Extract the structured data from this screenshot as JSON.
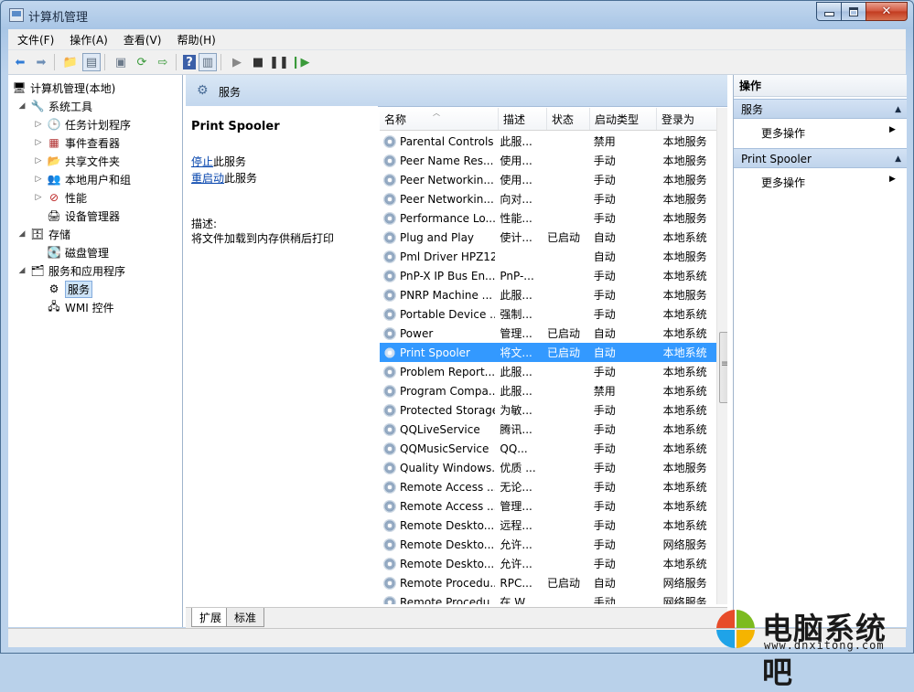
{
  "window": {
    "title": "计算机管理"
  },
  "menu": [
    "文件(F)",
    "操作(A)",
    "查看(V)",
    "帮助(H)"
  ],
  "tree": {
    "root": "计算机管理(本地)",
    "system_tools": "系统工具",
    "task_scheduler": "任务计划程序",
    "event_viewer": "事件查看器",
    "shared_folders": "共享文件夹",
    "local_users": "本地用户和组",
    "performance": "性能",
    "device_manager": "设备管理器",
    "storage": "存储",
    "disk_management": "磁盘管理",
    "services_apps": "服务和应用程序",
    "services": "服务",
    "wmi": "WMI 控件"
  },
  "middle": {
    "header": "服务",
    "detail_title": "Print Spooler",
    "stop_link": "停止",
    "stop_suffix": "此服务",
    "restart_link": "重启动",
    "restart_suffix": "此服务",
    "desc_label": "描述:",
    "desc_text": "将文件加载到内存供稍后打印",
    "tabs": [
      "扩展",
      "标准"
    ]
  },
  "list": {
    "columns": [
      "名称",
      "描述",
      "状态",
      "启动类型",
      "登录为"
    ],
    "rows": [
      [
        "Parental Controls",
        "此服...",
        "",
        "禁用",
        "本地服务"
      ],
      [
        "Peer Name Res...",
        "使用...",
        "",
        "手动",
        "本地服务"
      ],
      [
        "Peer Networkin...",
        "使用...",
        "",
        "手动",
        "本地服务"
      ],
      [
        "Peer Networkin...",
        "向对...",
        "",
        "手动",
        "本地服务"
      ],
      [
        "Performance Lo...",
        "性能...",
        "",
        "手动",
        "本地服务"
      ],
      [
        "Plug and Play",
        "使计...",
        "已启动",
        "自动",
        "本地系统"
      ],
      [
        "Pml Driver HPZ12",
        "",
        "",
        "自动",
        "本地服务"
      ],
      [
        "PnP-X IP Bus En...",
        "PnP-...",
        "",
        "手动",
        "本地系统"
      ],
      [
        "PNRP Machine ...",
        "此服...",
        "",
        "手动",
        "本地服务"
      ],
      [
        "Portable Device ...",
        "强制...",
        "",
        "手动",
        "本地系统"
      ],
      [
        "Power",
        "管理...",
        "已启动",
        "自动",
        "本地系统"
      ],
      [
        "Print Spooler",
        "将文...",
        "已启动",
        "自动",
        "本地系统"
      ],
      [
        "Problem Report...",
        "此服...",
        "",
        "手动",
        "本地系统"
      ],
      [
        "Program Compa...",
        "此服...",
        "",
        "禁用",
        "本地系统"
      ],
      [
        "Protected Storage",
        "为敏...",
        "",
        "手动",
        "本地系统"
      ],
      [
        "QQLiveService",
        "腾讯...",
        "",
        "手动",
        "本地系统"
      ],
      [
        "QQMusicService",
        "QQ...",
        "",
        "手动",
        "本地系统"
      ],
      [
        "Quality Windows...",
        "优质 ...",
        "",
        "手动",
        "本地服务"
      ],
      [
        "Remote Access ...",
        "无论...",
        "",
        "手动",
        "本地系统"
      ],
      [
        "Remote Access ...",
        "管理...",
        "",
        "手动",
        "本地系统"
      ],
      [
        "Remote Deskto...",
        "远程...",
        "",
        "手动",
        "本地系统"
      ],
      [
        "Remote Deskto...",
        "允许...",
        "",
        "手动",
        "网络服务"
      ],
      [
        "Remote Deskto...",
        "允许...",
        "",
        "手动",
        "本地系统"
      ],
      [
        "Remote Procedu...",
        "RPC...",
        "已启动",
        "自动",
        "网络服务"
      ],
      [
        "Remote Procedu...",
        "在 W...",
        "",
        "手动",
        "网络服务"
      ]
    ],
    "selected_index": 11
  },
  "actions": {
    "title": "操作",
    "section1": "服务",
    "more1": "更多操作",
    "section2": "Print Spooler",
    "more2": "更多操作"
  },
  "watermark": {
    "text": "电脑系统吧",
    "url": "www.dnxitong.com"
  }
}
